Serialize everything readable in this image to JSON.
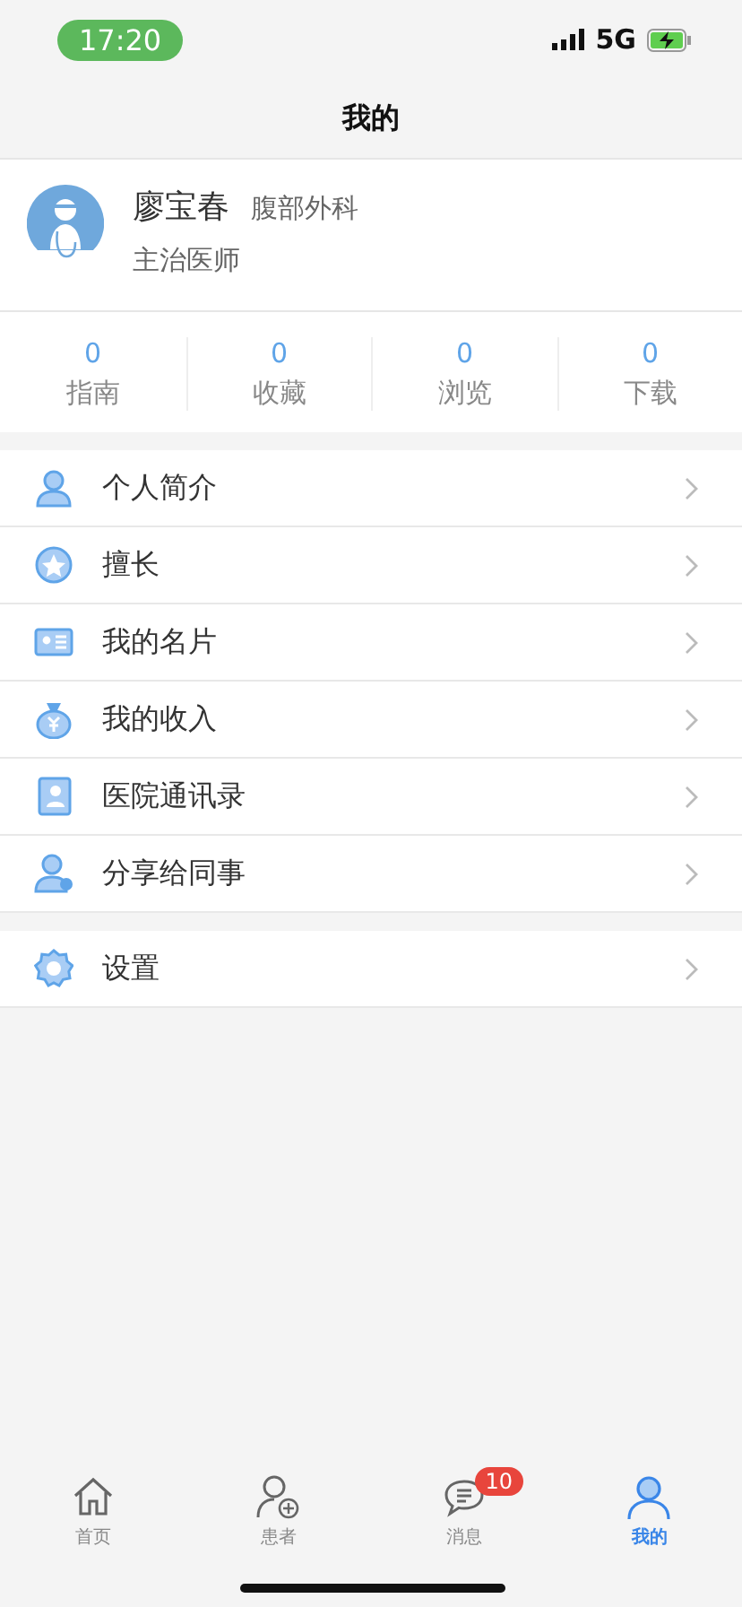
{
  "status_bar": {
    "time": "17:20",
    "network": "5G"
  },
  "nav": {
    "title": "我的"
  },
  "profile": {
    "name": "廖宝春",
    "department": "腹部外科",
    "title": "主治医师"
  },
  "stats": [
    {
      "value": "0",
      "label": "指南"
    },
    {
      "value": "0",
      "label": "收藏"
    },
    {
      "value": "0",
      "label": "浏览"
    },
    {
      "value": "0",
      "label": "下载"
    }
  ],
  "menu_groups": [
    [
      {
        "kind": "person",
        "label": "个人简介"
      },
      {
        "kind": "star",
        "label": "擅长"
      },
      {
        "kind": "card",
        "label": "我的名片"
      },
      {
        "kind": "money",
        "label": "我的收入"
      },
      {
        "kind": "contacts",
        "label": "医院通讯录"
      },
      {
        "kind": "share",
        "label": "分享给同事"
      }
    ],
    [
      {
        "kind": "gear",
        "label": "设置"
      }
    ]
  ],
  "tab_bar": [
    {
      "kind": "home",
      "label": "首页",
      "selected": false
    },
    {
      "kind": "patient",
      "label": "患者",
      "selected": false
    },
    {
      "kind": "message",
      "label": "消息",
      "selected": false,
      "badge": "10"
    },
    {
      "kind": "me",
      "label": "我的",
      "selected": true
    }
  ]
}
